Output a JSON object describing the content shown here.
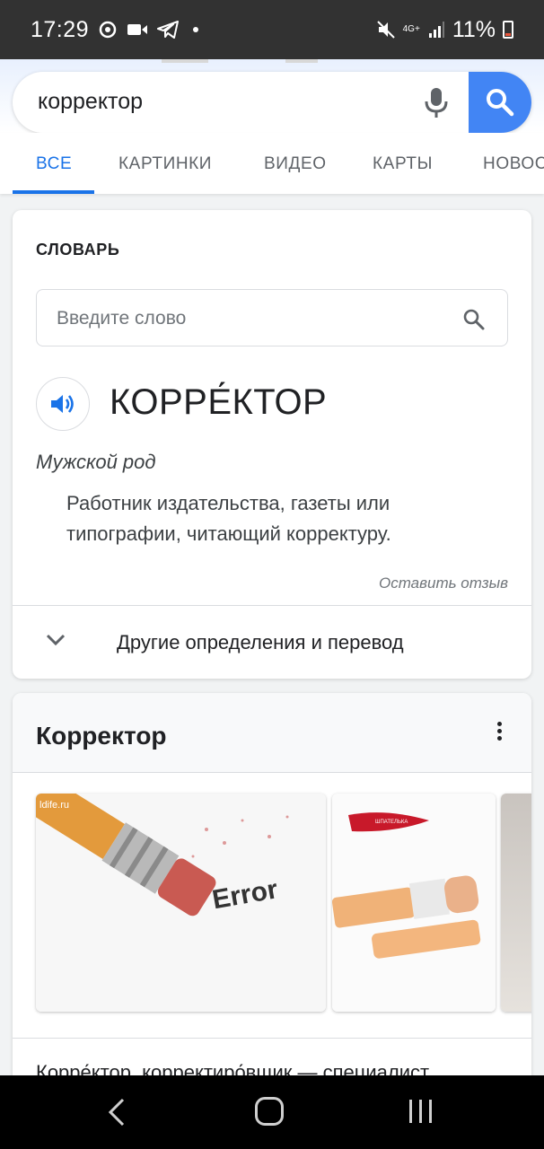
{
  "status_bar": {
    "time": "17:29",
    "network": "4G+",
    "battery": "11%"
  },
  "search": {
    "query": "корректор",
    "mic_icon": "mic-icon",
    "search_icon": "search-icon"
  },
  "tabs": [
    {
      "label": "ВСЕ",
      "active": true
    },
    {
      "label": "КАРТИНКИ",
      "active": false
    },
    {
      "label": "ВИДЕО",
      "active": false
    },
    {
      "label": "КАРТЫ",
      "active": false
    },
    {
      "label": "НОВОС",
      "active": false
    }
  ],
  "dictionary": {
    "title": "СЛОВАРЬ",
    "input_placeholder": "Введите слово",
    "word": "КОРРЕ́КТОР",
    "part_of_speech": "Мужской род",
    "definition": "Работник издательства, газеты или типографии, читающий корректуру.",
    "feedback": "Оставить отзыв",
    "more_label": "Другие определения и перевод"
  },
  "knowledge": {
    "title": "Корректор",
    "snippet": "Корре́ктор, корректиро́вщик — специалист",
    "images": [
      {
        "caption_text": "Error",
        "watermark": "ldife.ru"
      },
      {
        "logo_text": "ШПАТЕЛЬКА"
      },
      {}
    ]
  },
  "colors": {
    "accent": "#1a73e8",
    "search_button": "#4285f4",
    "status_bar": "#323232"
  }
}
